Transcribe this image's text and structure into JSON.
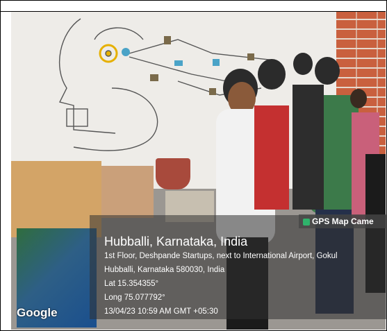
{
  "overlay": {
    "app_label": "GPS Map Came",
    "place": "Hubballi, Karnataka, India",
    "address_line1": "1st Floor, Deshpande Startups, next to International Airport, Gokul",
    "address_line2": "Hubballi, Karnataka 580030, India",
    "lat": "Lat 15.354355°",
    "long": "Long 75.077792°",
    "timestamp": "13/04/23 10:59 AM GMT +05:30",
    "map_brand": "Google"
  },
  "colors": {
    "brick": "#c9603e",
    "wall": "#eeece8",
    "mural_lines": "#555555"
  }
}
